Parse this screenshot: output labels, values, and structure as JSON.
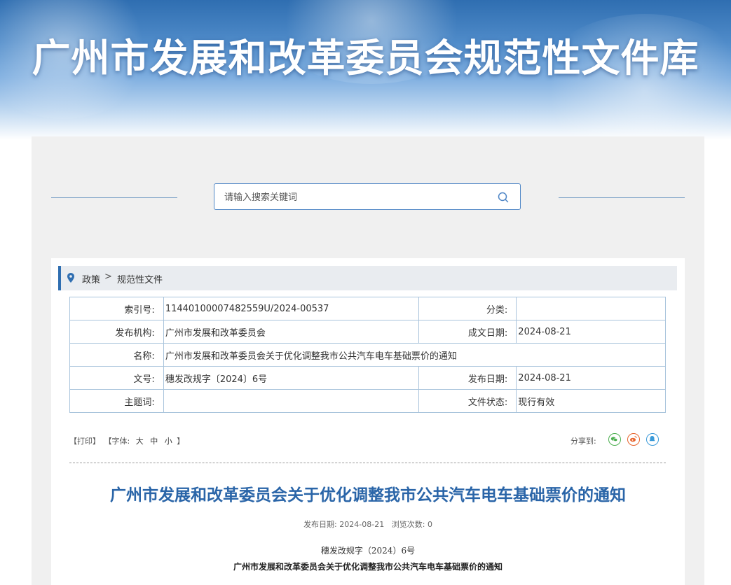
{
  "banner": {
    "title": "广州市发展和改革委员会规范性文件库"
  },
  "search": {
    "placeholder": "请输入搜索关键词"
  },
  "breadcrumb": {
    "level1": "政策",
    "separator": ">",
    "level2": "规范性文件"
  },
  "info": {
    "index_label": "索引号:",
    "index_value": "11440100007482559U/2024-00537",
    "category_label": "分类:",
    "category_value": "",
    "issuer_label": "发布机构:",
    "issuer_value": "广州市发展和改革委员会",
    "created_label": "成文日期:",
    "created_value": "2024-08-21",
    "name_label": "名称:",
    "name_value": "广州市发展和改革委员会关于优化调整我市公共汽车电车基础票价的通知",
    "docno_label": "文号:",
    "docno_value": "穗发改规字〔2024〕6号",
    "published_label": "发布日期:",
    "published_value": "2024-08-21",
    "subject_label": "主题词:",
    "subject_value": "",
    "status_label": "文件状态:",
    "status_value": "现行有效"
  },
  "tools": {
    "print": "【打印】",
    "font_open": "【字体:",
    "font_large": "大",
    "font_medium": "中",
    "font_small": "小",
    "font_close": "】",
    "share_label": "分享到:",
    "share_icons": [
      "wechat-icon",
      "weibo-icon",
      "qq-icon"
    ],
    "share_colors": {
      "wechat": "#4caf50",
      "weibo": "#e8642c",
      "qq": "#3a9ad9"
    }
  },
  "document": {
    "title": "广州市发展和改革委员会关于优化调整我市公共汽车电车基础票价的通知",
    "meta_date_label": "发布日期:",
    "meta_date": "2024-08-21",
    "meta_views_label": "浏览次数:",
    "meta_views": "0",
    "doc_number": "穗发改规字（2024）6号",
    "subtitle": "广州市发展和改革委员会关于优化调整我市公共汽车电车基础票价的通知"
  },
  "colors": {
    "accent": "#2f6eb1",
    "title_blue": "#2a65a8",
    "border": "#a9c4dc"
  }
}
